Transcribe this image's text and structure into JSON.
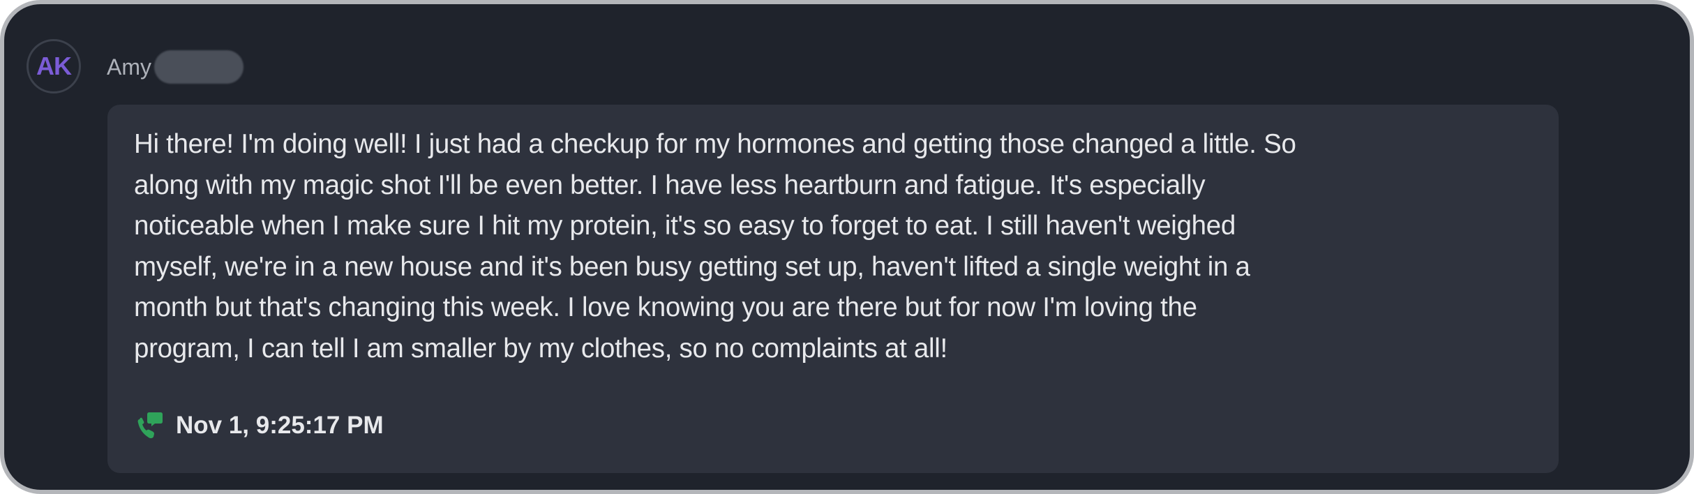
{
  "message": {
    "avatar_initials": "AK",
    "sender_name": "Amy",
    "body": "Hi there! I'm doing well! I just had a checkup for my hormones and getting those changed a little. So\nalong with my magic shot I'll be even better. I have less heartburn and fatigue. It's especially\nnoticeable when I make sure I hit my protein, it's so easy to forget to eat. I still haven't weighed\nmyself, we're in a new house and it's been busy getting set up, haven't lifted a single weight in a\nmonth but that's changing this week. I love knowing you are there but for now I'm loving the\nprogram, I can tell I am smaller by my clothes, so no complaints at all!",
    "timestamp": "Nov 1, 9:25:17 PM",
    "channel_icon": "phone-message-icon"
  },
  "colors": {
    "background": "#1f232c",
    "bubble": "#2e323d",
    "avatar_text": "#7b5cd6",
    "channel_icon": "#2fa35a",
    "text": "#e8e9ec"
  }
}
